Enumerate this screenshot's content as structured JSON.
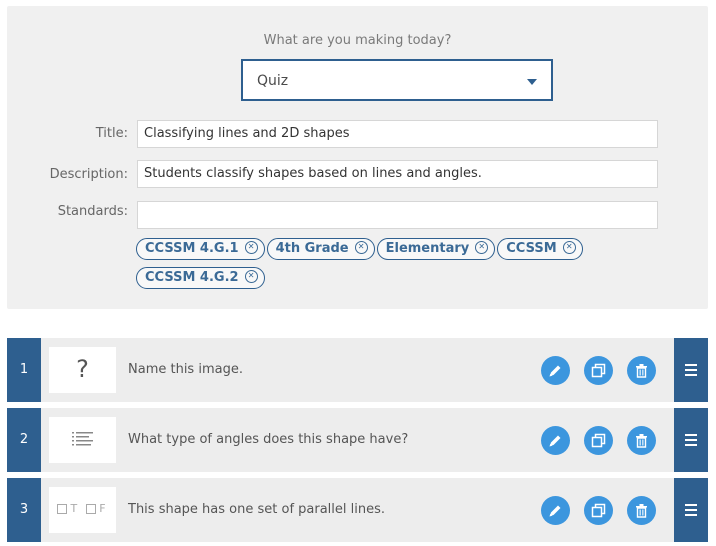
{
  "form": {
    "prompt": "What are you making today?",
    "type_selected": "Quiz",
    "title_label": "Title:",
    "title_value": "Classifying lines and 2D shapes",
    "description_label": "Description:",
    "description_value": "Students classify shapes based on lines and angles.",
    "standards_label": "Standards:",
    "standards_value": "",
    "tags": [
      "CCSSM 4.G.1",
      "4th Grade",
      "Elementary",
      "CCSSM",
      "CCSSM 4.G.2"
    ]
  },
  "questions": [
    {
      "number": "1",
      "thumb_icon": "question-mark-icon",
      "thumb_glyph": "?",
      "text": "Name this image."
    },
    {
      "number": "2",
      "thumb_icon": "list-icon",
      "text": "What type of angles does this shape have?"
    },
    {
      "number": "3",
      "thumb_icon": "true-false-icon",
      "tf_t": "T",
      "tf_f": "F",
      "text": "This shape has one set of parallel lines."
    }
  ],
  "colors": {
    "accent": "#2e5f8f",
    "action": "#3c96de",
    "panel": "#f0f0f0"
  }
}
